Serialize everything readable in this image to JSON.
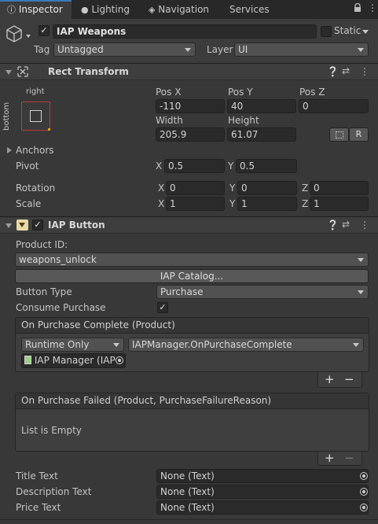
{
  "tabs": [
    {
      "label": "Inspector",
      "icon": "info-icon"
    },
    {
      "label": "Lighting",
      "icon": "bulb-icon"
    },
    {
      "label": "Navigation",
      "icon": "compass-icon"
    },
    {
      "label": "Services",
      "icon": ""
    }
  ],
  "gameobject": {
    "name": "IAP Weapons",
    "static_label": "Static",
    "tag_label": "Tag",
    "tag_value": "Untagged",
    "layer_label": "Layer",
    "layer_value": "UI"
  },
  "rect_transform": {
    "title": "Rect Transform",
    "anchor_h": "right",
    "anchor_v": "bottom",
    "pos_x_label": "Pos X",
    "pos_x": "-110",
    "pos_y_label": "Pos Y",
    "pos_y": "40",
    "pos_z_label": "Pos Z",
    "pos_z": "0",
    "width_label": "Width",
    "width": "205.9",
    "height_label": "Height",
    "height": "61.07",
    "r_btn": "R",
    "anchors_label": "Anchors",
    "pivot_label": "Pivot",
    "pivot_x": "0.5",
    "pivot_y": "0.5",
    "rotation_label": "Rotation",
    "rot_x": "0",
    "rot_y": "0",
    "rot_z": "0",
    "scale_label": "Scale",
    "scale_x": "1",
    "scale_y": "1",
    "scale_z": "1",
    "x": "X",
    "y": "Y",
    "z": "Z"
  },
  "iap_button": {
    "title": "IAP Button",
    "product_id_label": "Product ID:",
    "product_id": "weapons_unlock",
    "catalog_button": "IAP Catalog...",
    "button_type_label": "Button Type",
    "button_type": "Purchase",
    "consume_label": "Consume Purchase",
    "consume_checked": true,
    "on_complete_title": "On Purchase Complete (Product)",
    "runtime_value": "Runtime Only",
    "function_value": "IAPManager.OnPurchaseComplete",
    "object_value": "IAP Manager (IAP",
    "on_failed_title": "On Purchase Failed (Product, PurchaseFailureReason)",
    "list_empty": "List is Empty",
    "plus": "+",
    "minus": "−",
    "title_text_label": "Title Text",
    "title_text_value": "None (Text)",
    "description_text_label": "Description Text",
    "description_text_value": "None (Text)",
    "price_text_label": "Price Text",
    "price_text_value": "None (Text)"
  },
  "colors": {
    "background": "#383838",
    "tab_accent": "#3a79bb",
    "field_bg": "#2a2a2a"
  }
}
